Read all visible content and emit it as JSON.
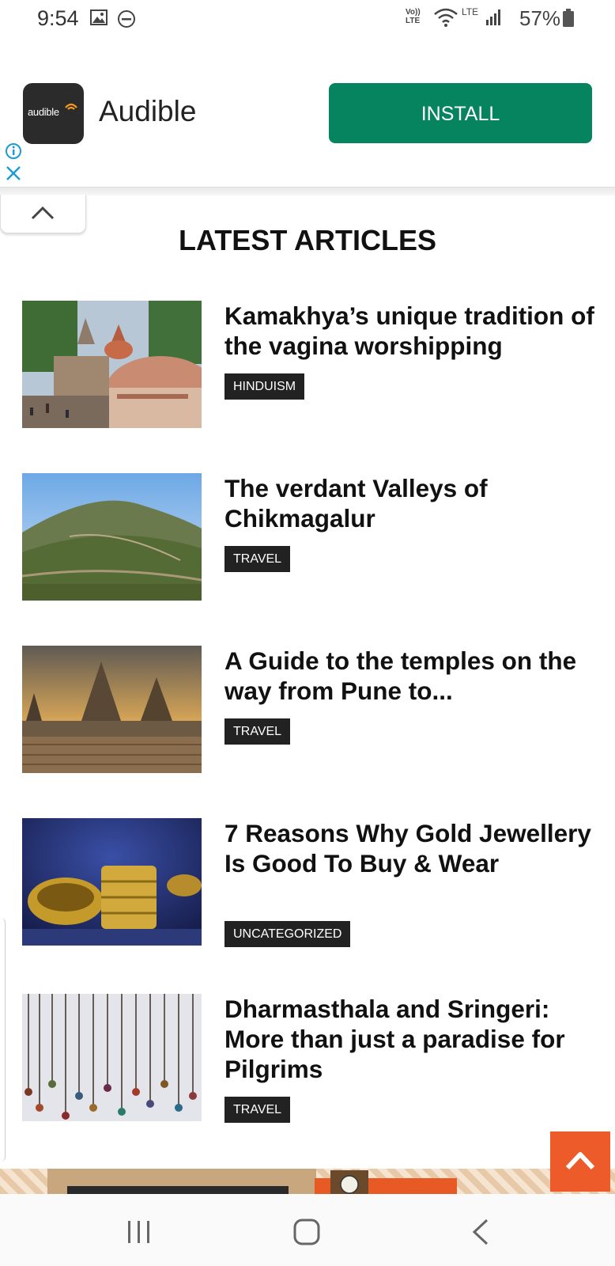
{
  "status_bar": {
    "time": "9:54",
    "net_label": "Vo)) LTE",
    "lte_label": "LTE",
    "battery": "57%"
  },
  "ad": {
    "brand_logo_text": "audible",
    "app_name": "Audible",
    "install_label": "INSTALL",
    "install_color": "#068460"
  },
  "section": {
    "title": "LATEST ARTICLES"
  },
  "articles": [
    {
      "title": "Kamakhya’s unique tradition of the vagina worshipping",
      "tag": "HINDUISM"
    },
    {
      "title": "The verdant Valleys of Chikmagalur",
      "tag": "TRAVEL"
    },
    {
      "title": "A Guide to the temples on the way from Pune to...",
      "tag": "TRAVEL"
    },
    {
      "title": "7 Reasons Why Gold Jewellery Is Good To Buy & Wear",
      "tag": "UNCATEGORIZED"
    },
    {
      "title": "Dharmasthala and Sringeri: More than just a paradise for Pilgrims",
      "tag": "TRAVEL"
    }
  ],
  "colors": {
    "back_to_top": "#ee5b2b",
    "tag_bg": "#222222"
  }
}
